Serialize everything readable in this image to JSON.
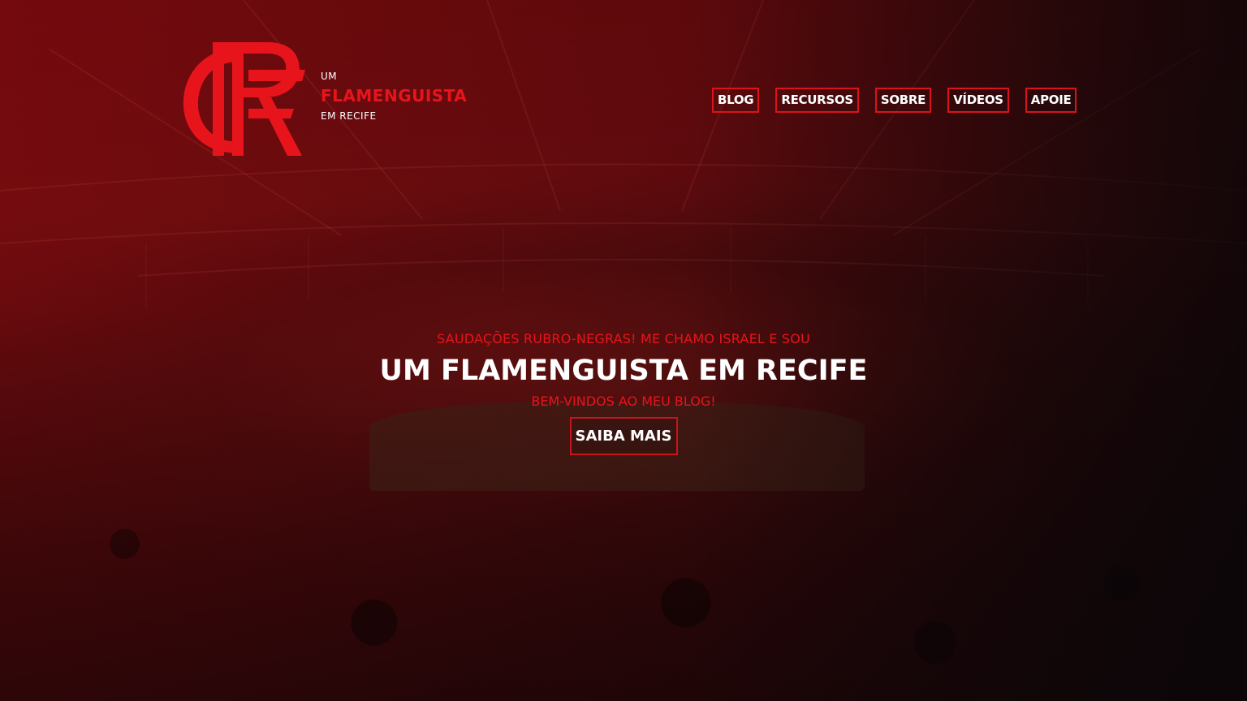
{
  "brand": {
    "prefix": "UM",
    "name": "FLAMENGUISTA",
    "suffix": "EM RECIFE",
    "logo_icon": "crf-monogram-icon",
    "accent_color": "#e8141c"
  },
  "nav": {
    "items": [
      {
        "label": "BLOG"
      },
      {
        "label": "RECURSOS"
      },
      {
        "label": "SOBRE"
      },
      {
        "label": "VÍDEOS"
      },
      {
        "label": "APOIE"
      }
    ]
  },
  "hero": {
    "kicker": "SAUDAÇÕES RUBRO-NEGRAS! ME CHAMO ISRAEL E SOU",
    "headline": "UM FLAMENGUISTA EM RECIFE",
    "subline": "BEM-VINDOS AO MEU BLOG!",
    "cta_label": "SAIBA MAIS",
    "background": "stadium-crowd-photo"
  }
}
